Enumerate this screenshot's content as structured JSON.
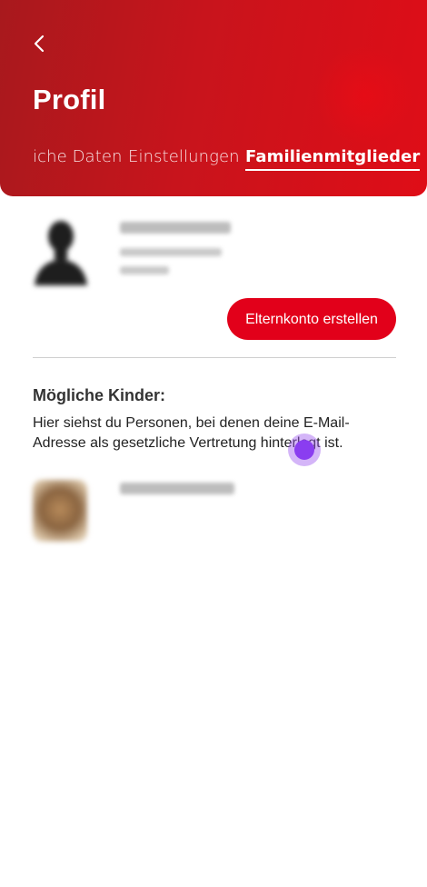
{
  "header": {
    "title": "Profil",
    "back_icon": "chevron-left-icon",
    "tabs": [
      {
        "label": "iche Daten",
        "active": false
      },
      {
        "label": "Einstellungen",
        "active": false
      },
      {
        "label": "Familienmitglieder",
        "active": true
      }
    ]
  },
  "account": {
    "avatar_icon": "person-silhouette-icon",
    "parent_button_label": "Elternkonto erstellen"
  },
  "children": {
    "title": "Mögliche Kinder:",
    "description": "Hier siehst du Personen, bei denen deine E-Mail-Adresse als gesetzliche Vertretung hinterlegt ist."
  },
  "colors": {
    "brand_red": "#e2001a",
    "header_dark_red": "#a8191d",
    "touch_indicator": "#8a3df0"
  }
}
